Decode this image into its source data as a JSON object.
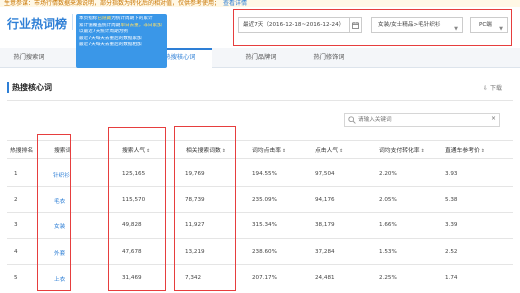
{
  "notice": {
    "text": "生意参谋：市场行情数据来源说明，部分指数为转化后的相对值，仅供参考使用；",
    "link": "查看详情"
  },
  "header": {
    "title": "行业热词榜",
    "tooltip_lines": [
      {
        "pre": "本页指标",
        "hl": "已隐藏",
        "post": "为统计周期下的累计"
      },
      {
        "pre": "累计值覆盖统计周期",
        "hl": "单日去重，非日累加",
        "post": ""
      },
      {
        "pre": "以最近7天统计周期为例",
        "hl": "",
        "post": ""
      },
      {
        "pre": "最近7天每天去重后的数据累加",
        "hl": "",
        "post": ""
      },
      {
        "pre": "最近7天每天去重后的数据相加",
        "hl": "",
        "post": ""
      }
    ],
    "date_range": "最近7天（2016-12-18~2016-12-24）",
    "category": "女装/女士精品>毛针织衫",
    "device": "PC端"
  },
  "tabs": [
    {
      "label": "热门搜索词",
      "active": false
    },
    {
      "label": "热搜核心词",
      "active": true
    },
    {
      "label": "热门品牌词",
      "active": false
    },
    {
      "label": "热门修饰词",
      "active": false
    }
  ],
  "section": {
    "title": "热搜核心词",
    "download": "下载"
  },
  "search": {
    "placeholder": "请输入关键词",
    "clear": "×"
  },
  "table": {
    "columns": [
      "热搜排名",
      "搜索词",
      "搜索人气",
      "相关搜索词数",
      "词均点击率",
      "点击人气",
      "词均支付转化率",
      "直通车参考价"
    ],
    "sortable": [
      false,
      false,
      true,
      true,
      true,
      true,
      true,
      true
    ],
    "rows": [
      {
        "rank": "1",
        "word": "针织衫",
        "popularity": "125,165",
        "related": "19,769",
        "ctr": "194.55%",
        "click_pop": "97,504",
        "conv": "2.20%",
        "price": "3.93"
      },
      {
        "rank": "2",
        "word": "毛衣",
        "popularity": "115,570",
        "related": "78,739",
        "ctr": "235.09%",
        "click_pop": "94,176",
        "conv": "2.05%",
        "price": "5.38"
      },
      {
        "rank": "3",
        "word": "女装",
        "popularity": "49,828",
        "related": "11,927",
        "ctr": "315.34%",
        "click_pop": "38,179",
        "conv": "1.66%",
        "price": "3.39"
      },
      {
        "rank": "4",
        "word": "外套",
        "popularity": "47,678",
        "related": "13,219",
        "ctr": "238.60%",
        "click_pop": "37,284",
        "conv": "1.53%",
        "price": "2.52"
      },
      {
        "rank": "5",
        "word": "上衣",
        "popularity": "31,469",
        "related": "7,342",
        "ctr": "207.17%",
        "click_pop": "24,481",
        "conv": "2.25%",
        "price": "1.74"
      }
    ]
  },
  "colors": {
    "accent": "#2e7fd6",
    "tooltip_bg": "#3a97e8",
    "annotation_red": "#e63e3e"
  }
}
